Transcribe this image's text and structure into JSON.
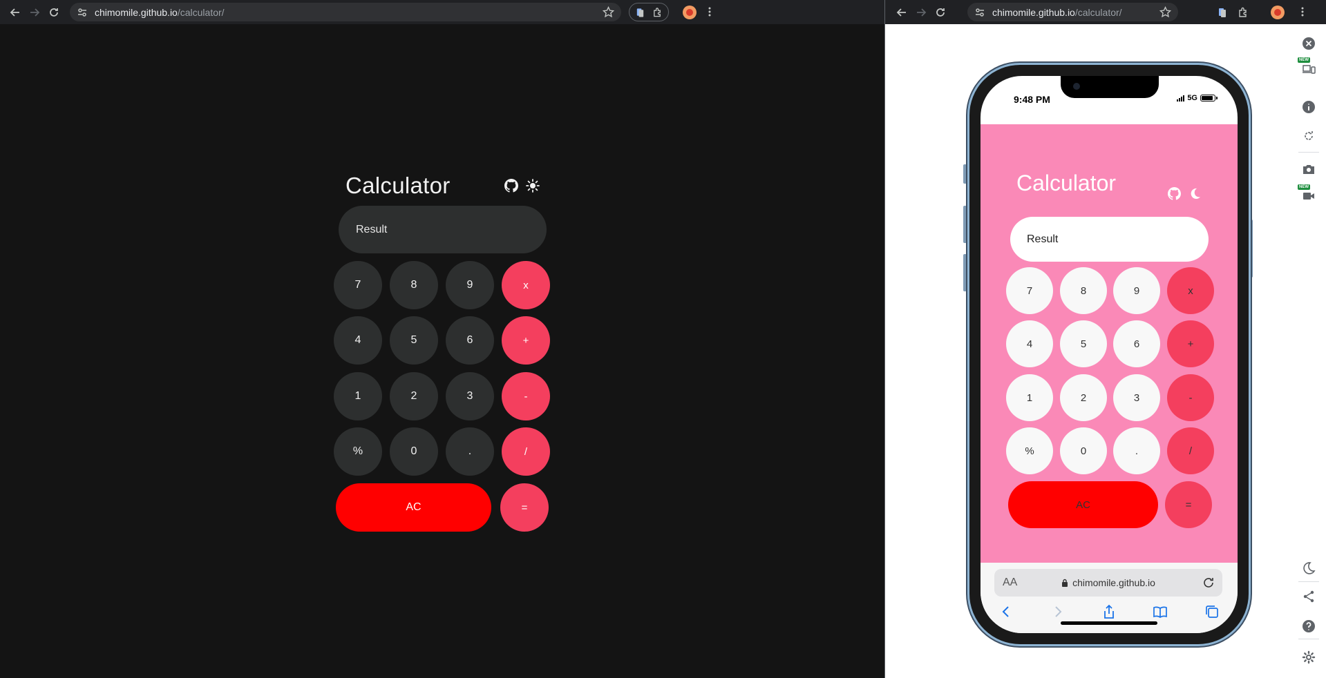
{
  "left_browser": {
    "url_host": "chimomile.github.io",
    "url_path": "/calculator/"
  },
  "right_browser": {
    "url_host": "chimomile.github.io",
    "url_path": "/calculator/"
  },
  "calculator_desktop": {
    "title": "Calculator",
    "result_placeholder": "Result",
    "theme_icon": "sun-icon",
    "keys": [
      "7",
      "8",
      "9",
      "x",
      "4",
      "5",
      "6",
      "+",
      "1",
      "2",
      "3",
      "-",
      "%",
      "0",
      ".",
      "/",
      "AC",
      "="
    ],
    "colors": {
      "background": "#141414",
      "key": "#2d2f2f",
      "operator": "#f43f5e",
      "clear": "#ff0000"
    }
  },
  "phone": {
    "status_time": "9:48 PM",
    "network": "5G",
    "battery_level": 0.9,
    "safari_aa": "AA",
    "safari_url": "chimomile.github.io"
  },
  "calculator_mobile": {
    "title": "Calculator",
    "result_placeholder": "Result",
    "theme_icon": "moon-icon",
    "keys": [
      "7",
      "8",
      "9",
      "x",
      "4",
      "5",
      "6",
      "+",
      "1",
      "2",
      "3",
      "-",
      "%",
      "0",
      ".",
      "/",
      "AC",
      "="
    ],
    "colors": {
      "background": "#fa89b7",
      "key": "#f8f8f8",
      "operator": "#f43f5e",
      "clear": "#ff0000"
    }
  },
  "devtools_side": {
    "new_badge": "NEW"
  }
}
